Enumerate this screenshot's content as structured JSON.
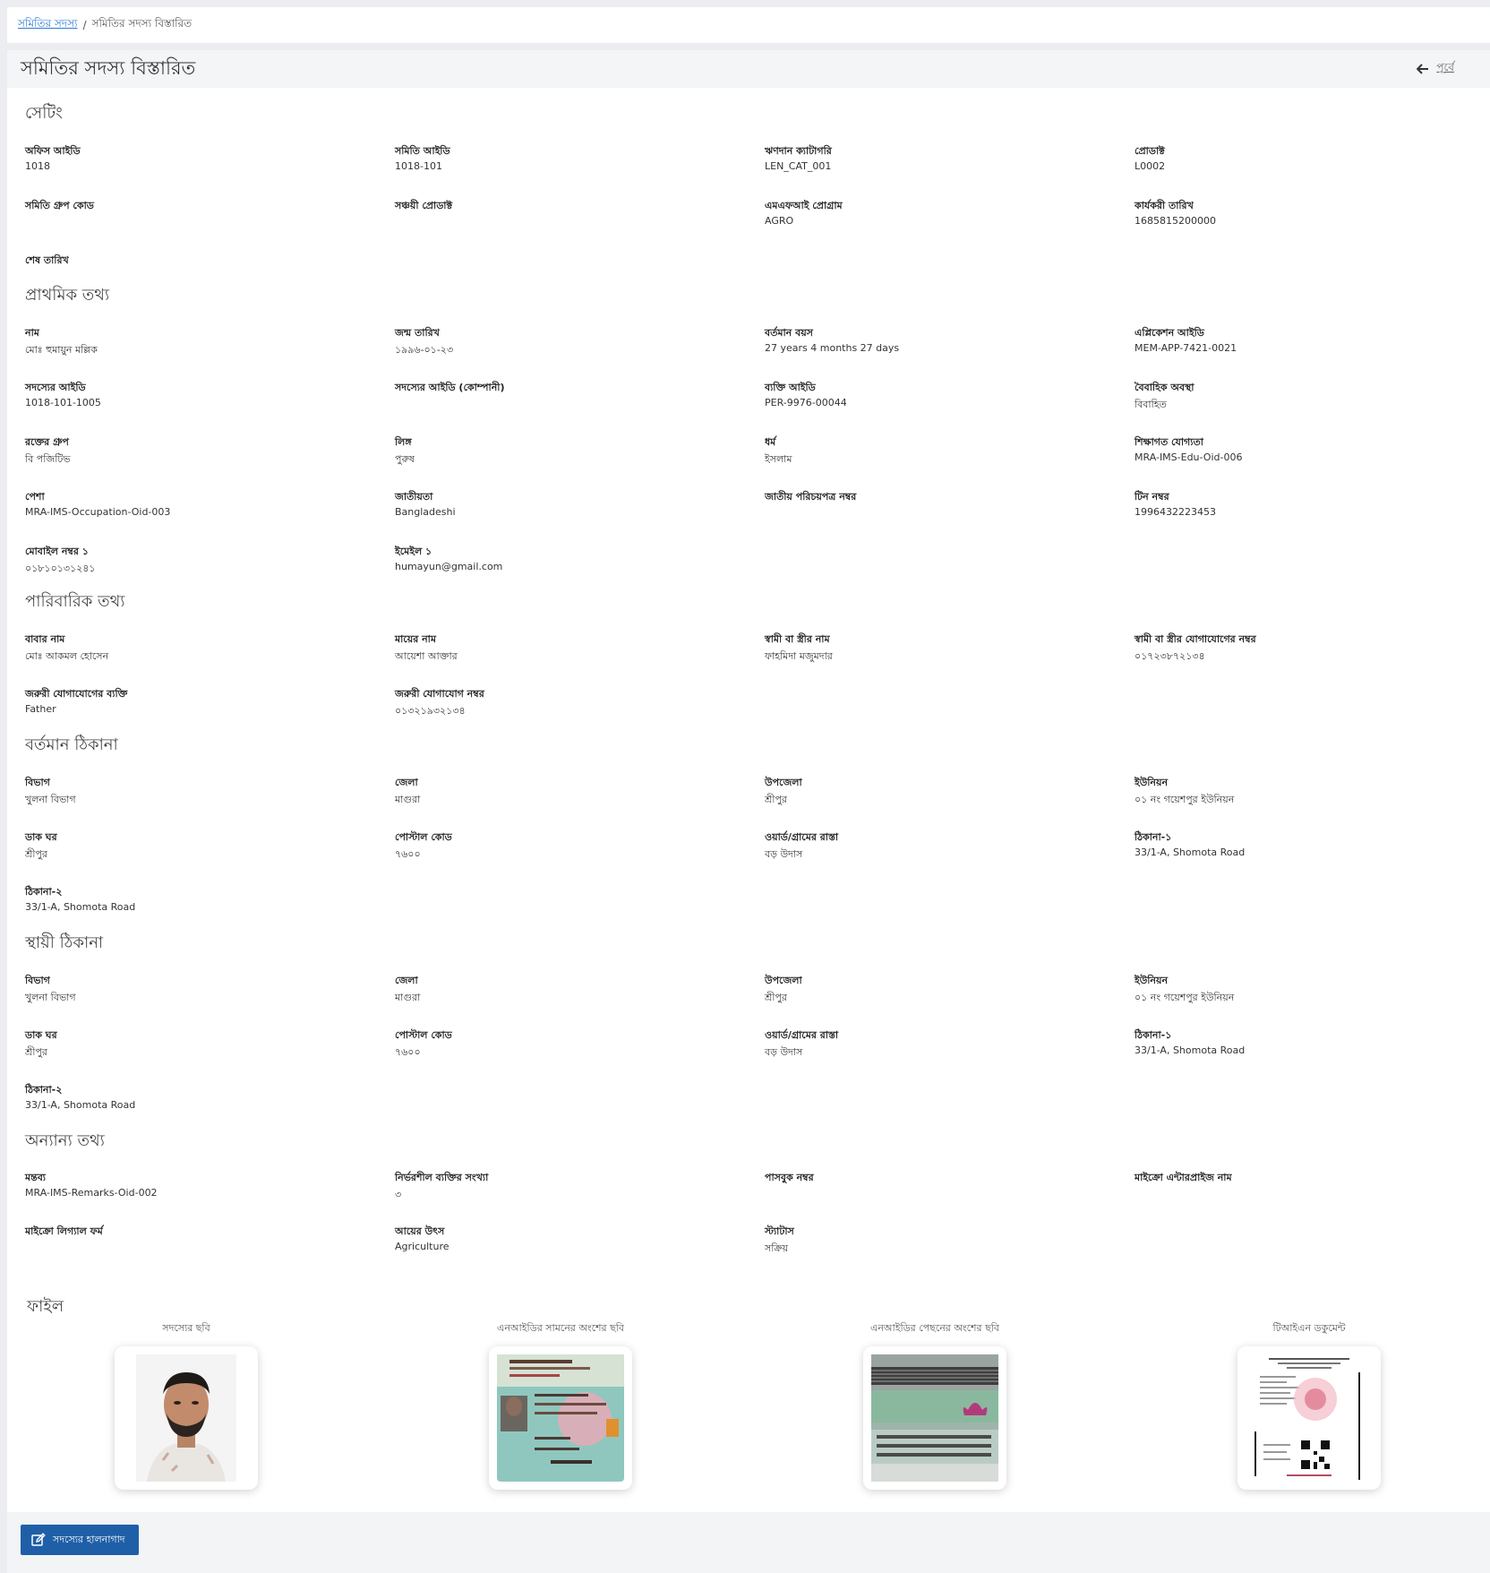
{
  "breadcrumb": {
    "parent": "সমিতির সদস্য",
    "separator": "/",
    "current": "সমিতির সদস্য বিস্তারিত"
  },
  "header": {
    "title": "সমিতির সদস্য বিস্তারিত",
    "back_label": "পূর্বে"
  },
  "sections": {
    "setting": {
      "title": "সেটিং",
      "fields": [
        {
          "label": "অফিস আইডি",
          "value": "1018"
        },
        {
          "label": "সমিতি আইডি",
          "value": "1018-101"
        },
        {
          "label": "ঋণদান ক্যাটাগরি",
          "value": "LEN_CAT_001"
        },
        {
          "label": "প্রোডাক্ট",
          "value": "L0002"
        },
        {
          "label": "সমিতি গ্রুপ কোড",
          "value": ""
        },
        {
          "label": "সঞ্চয়ী প্রোডাক্ট",
          "value": ""
        },
        {
          "label": "এমএফআই প্রোগ্রাম",
          "value": "AGRO"
        },
        {
          "label": "কার্যকরী তারিখ",
          "value": "1685815200000"
        },
        {
          "label": "শেষ তারিখ",
          "value": ""
        }
      ]
    },
    "primary": {
      "title": "প্রাথমিক তথ্য",
      "fields": [
        {
          "label": "নাম",
          "value": "মোঃ হুমায়ুন মল্লিক"
        },
        {
          "label": "জন্ম তারিখ",
          "value": "১৯৯৬-০১-২৩"
        },
        {
          "label": "বর্তমান বয়স",
          "value": "27 years 4 months 27 days"
        },
        {
          "label": "এপ্লিকেশন আইডি",
          "value": "MEM-APP-7421-0021"
        },
        {
          "label": "সদস্যের আইডি",
          "value": "1018-101-1005"
        },
        {
          "label": "সদস্যের আইডি (কোম্পানী)",
          "value": ""
        },
        {
          "label": "ব্যক্তি আইডি",
          "value": "PER-9976-00044"
        },
        {
          "label": "বৈবাহিক অবস্থা",
          "value": "বিবাহিত"
        },
        {
          "label": "রক্তের গ্রুপ",
          "value": "বি পজিটিভ"
        },
        {
          "label": "লিঙ্গ",
          "value": "পুরুষ"
        },
        {
          "label": "ধর্ম",
          "value": "ইসলাম"
        },
        {
          "label": "শিক্ষাগত যোগ্যতা",
          "value": "MRA-IMS-Edu-Oid-006"
        },
        {
          "label": "পেশা",
          "value": "MRA-IMS-Occupation-Oid-003"
        },
        {
          "label": "জাতীয়তা",
          "value": "Bangladeshi"
        },
        {
          "label": "জাতীয় পরিচয়পত্র নম্বর",
          "value": ""
        },
        {
          "label": "টিন নম্বর",
          "value": "1996432223453"
        },
        {
          "label": "মোবাইল নম্বর ১",
          "value": "০১৮১০১৩১২৪১"
        },
        {
          "label": "ইমেইল ১",
          "value": "humayun@gmail.com"
        }
      ]
    },
    "family": {
      "title": "পারিবারিক তথ্য",
      "fields": [
        {
          "label": "বাবার নাম",
          "value": "মোঃ আকমল হোসেন"
        },
        {
          "label": "মায়ের নাম",
          "value": "আয়েশা আক্তার"
        },
        {
          "label": "স্বামী বা স্ত্রীর নাম",
          "value": "ফাহমিদা মজুমদার"
        },
        {
          "label": "স্বামী বা স্ত্রীর যোগাযোগের নম্বর",
          "value": "০১৭২৩৮৭২১৩৪"
        },
        {
          "label": "জরুরী যোগাযোগের ব্যক্তি",
          "value": "Father"
        },
        {
          "label": "জরুরী যোগাযোগ নম্বর",
          "value": "০১৩২১৯৩২১৩৪"
        }
      ]
    },
    "present_address": {
      "title": "বর্তমান ঠিকানা",
      "fields": [
        {
          "label": "বিভাগ",
          "value": "খুলনা বিভাগ"
        },
        {
          "label": "জেলা",
          "value": "মাগুরা"
        },
        {
          "label": "উপজেলা",
          "value": "শ্রীপুর"
        },
        {
          "label": "ইউনিয়ন",
          "value": "০১ নং গয়েশপুর ইউনিয়ন"
        },
        {
          "label": "ডাক ঘর",
          "value": "শ্রীপুর"
        },
        {
          "label": "পোস্টাল কোড",
          "value": "৭৬০০"
        },
        {
          "label": "ওয়ার্ড/গ্রামের রাস্তা",
          "value": "বড় উদাস"
        },
        {
          "label": "ঠিকানা-১",
          "value": "33/1-A, Shomota Road"
        },
        {
          "label": "ঠিকানা-২",
          "value": "33/1-A, Shomota Road"
        }
      ]
    },
    "permanent_address": {
      "title": "স্থায়ী ঠিকানা",
      "fields": [
        {
          "label": "বিভাগ",
          "value": "খুলনা বিভাগ"
        },
        {
          "label": "জেলা",
          "value": "মাগুরা"
        },
        {
          "label": "উপজেলা",
          "value": "শ্রীপুর"
        },
        {
          "label": "ইউনিয়ন",
          "value": "০১ নং গয়েশপুর ইউনিয়ন"
        },
        {
          "label": "ডাক ঘর",
          "value": "শ্রীপুর"
        },
        {
          "label": "পোস্টাল কোড",
          "value": "৭৬০০"
        },
        {
          "label": "ওয়ার্ড/গ্রামের রাস্তা",
          "value": "বড় উদাস"
        },
        {
          "label": "ঠিকানা-১",
          "value": "33/1-A, Shomota Road"
        },
        {
          "label": "ঠিকানা-২",
          "value": "33/1-A, Shomota Road"
        }
      ]
    },
    "other": {
      "title": "অন্যান্য তথ্য",
      "fields": [
        {
          "label": "মন্তব্য",
          "value": "MRA-IMS-Remarks-Oid-002"
        },
        {
          "label": "নির্ভরশীল ব্যক্তির সংখ্যা",
          "value": "৩"
        },
        {
          "label": "পাসবুক নম্বর",
          "value": ""
        },
        {
          "label": "মাইক্রো এন্টারপ্রাইজ নাম",
          "value": ""
        },
        {
          "label": "মাইক্রো লিগ্যাল ফর্ম",
          "value": ""
        },
        {
          "label": "আয়ের উৎস",
          "value": "Agriculture"
        },
        {
          "label": "স্ট্যাটাস",
          "value": "সক্রিয়"
        }
      ]
    }
  },
  "files": {
    "title": "ফাইল",
    "items": [
      {
        "label": "সদস্যের ছবি",
        "icon": "member-photo-icon"
      },
      {
        "label": "এনআইডির সামনের অংশের ছবি",
        "icon": "nid-front-icon"
      },
      {
        "label": "এনআইডির পেছনের অংশের ছবি",
        "icon": "nid-back-icon"
      },
      {
        "label": "টিআইএন ডকুমেন্ট",
        "icon": "tin-document-icon"
      }
    ]
  },
  "footer": {
    "edit_label": "সদস্যের হালনাগাদ"
  },
  "colors": {
    "accent": "#1f5fa8",
    "link": "#2b7bd1"
  }
}
